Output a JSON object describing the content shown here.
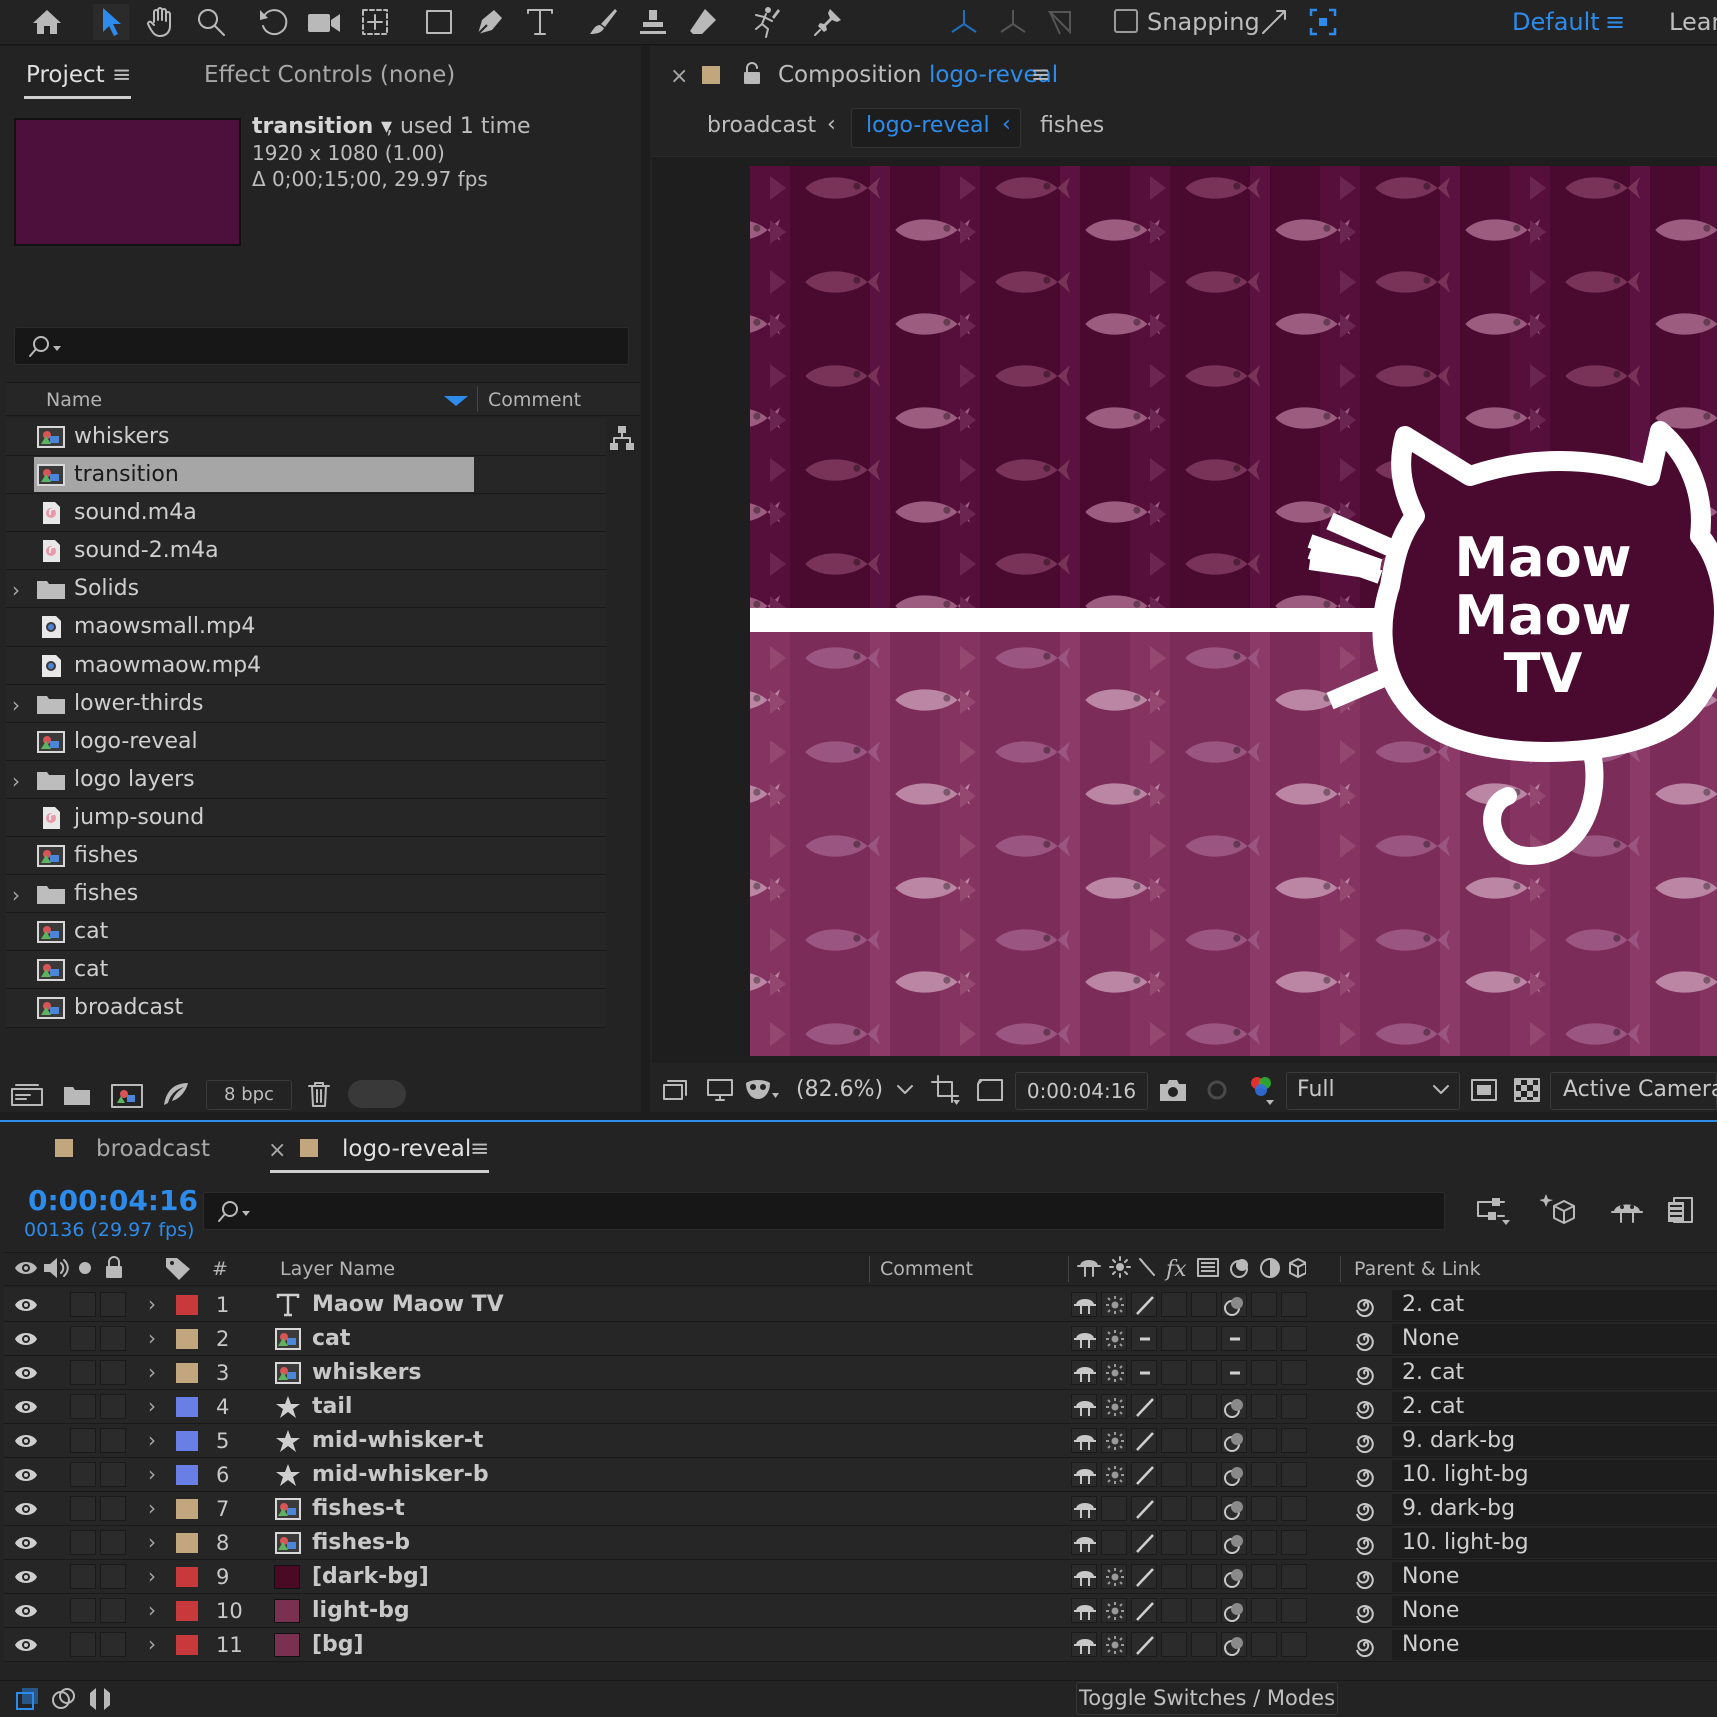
{
  "toolbar": {
    "snapping_label": "Snapping",
    "workspace": "Default",
    "workspace_menu": "≡",
    "learn": "Learn"
  },
  "project_panel": {
    "tab_project": "Project",
    "tab_menu": "≡",
    "tab_effect_controls": "Effect Controls (none)",
    "selected_info": {
      "name": "transition ▾",
      "used": ", used 1 time",
      "resolution": "1920 x 1080 (1.00)",
      "duration": "Δ 0;00;15;00, 29.97 fps",
      "thumb_color": "#4d0f3c"
    },
    "columns": {
      "name": "Name",
      "comment": "Comment"
    },
    "items": [
      {
        "label": "whiskers",
        "icon": "composition-icon"
      },
      {
        "label": "transition",
        "icon": "composition-icon",
        "selected": true
      },
      {
        "label": "sound.m4a",
        "icon": "audio-file-icon"
      },
      {
        "label": "sound-2.m4a",
        "icon": "audio-file-icon"
      },
      {
        "label": "Solids",
        "icon": "folder-icon",
        "folder": true
      },
      {
        "label": "maowsmall.mp4",
        "icon": "video-file-icon"
      },
      {
        "label": "maowmaow.mp4",
        "icon": "video-file-icon"
      },
      {
        "label": "lower-thirds",
        "icon": "folder-icon",
        "folder": true
      },
      {
        "label": "logo-reveal",
        "icon": "composition-icon"
      },
      {
        "label": "logo layers",
        "icon": "folder-icon",
        "folder": true
      },
      {
        "label": "jump-sound",
        "icon": "audio-file-icon"
      },
      {
        "label": "fishes",
        "icon": "composition-icon"
      },
      {
        "label": "fishes",
        "icon": "folder-icon",
        "folder": true
      },
      {
        "label": "cat",
        "icon": "composition-icon"
      },
      {
        "label": "cat",
        "icon": "composition-icon"
      },
      {
        "label": "broadcast",
        "icon": "composition-icon"
      }
    ],
    "bpc": "8 bpc"
  },
  "composition_panel": {
    "close": "×",
    "title_prefix": "Composition",
    "title_name": "logo-reveal",
    "menu": "≡",
    "breadcrumbs": {
      "left": "broadcast",
      "active": "logo-reveal",
      "right": "fishes"
    },
    "logo_text": [
      "Maow",
      "Maow",
      "TV"
    ],
    "zoom": "(82.6%)",
    "timecode": "0:00:04:16",
    "resolution": "Full",
    "camera": "Active Camera",
    "colors": {
      "dark_bg": "#4a0a30",
      "light_bg": "#7b2c58",
      "cat_fill": "#4a0a30",
      "stripe": "#ffffff"
    }
  },
  "timeline_panel": {
    "tab1": "broadcast",
    "close": "×",
    "tab2": "logo-reveal",
    "tab_menu": "≡",
    "current_time": "0:00:04:16",
    "frames": "00136 (29.97 fps)",
    "headers": {
      "number": "#",
      "layer_name": "Layer Name",
      "comment": "Comment",
      "parent": "Parent & Link"
    },
    "layers": [
      {
        "num": "1",
        "name": "Maow Maow TV",
        "type": "text",
        "label_color": "#c8393c",
        "parent": "2. cat"
      },
      {
        "num": "2",
        "name": "cat",
        "type": "comp",
        "label_color": "#c2a77e",
        "parent": "None"
      },
      {
        "num": "3",
        "name": "whiskers",
        "type": "comp",
        "label_color": "#c2a77e",
        "parent": "2. cat"
      },
      {
        "num": "4",
        "name": "tail",
        "type": "shape",
        "label_color": "#6a7fe6",
        "parent": "2. cat"
      },
      {
        "num": "5",
        "name": "mid-whisker-t",
        "type": "shape",
        "label_color": "#6a7fe6",
        "parent": "9. dark-bg"
      },
      {
        "num": "6",
        "name": "mid-whisker-b",
        "type": "shape",
        "label_color": "#6a7fe6",
        "parent": "10. light-bg"
      },
      {
        "num": "7",
        "name": "fishes-t",
        "type": "comp",
        "label_color": "#c2a77e",
        "parent": "9. dark-bg"
      },
      {
        "num": "8",
        "name": "fishes-b",
        "type": "comp",
        "label_color": "#c2a77e",
        "parent": "10. light-bg"
      },
      {
        "num": "9",
        "name": "[dark-bg]",
        "type": "solid",
        "label_color": "#c8393c",
        "swatch": "#4a0a24",
        "parent": "None"
      },
      {
        "num": "10",
        "name": "light-bg",
        "type": "solid",
        "label_color": "#c8393c",
        "swatch": "#7a3050",
        "parent": "None"
      },
      {
        "num": "11",
        "name": "[bg]",
        "type": "solid",
        "label_color": "#c8393c",
        "swatch": "#7a3050",
        "parent": "None"
      }
    ],
    "toggle_label": "Toggle Switches / Modes"
  }
}
